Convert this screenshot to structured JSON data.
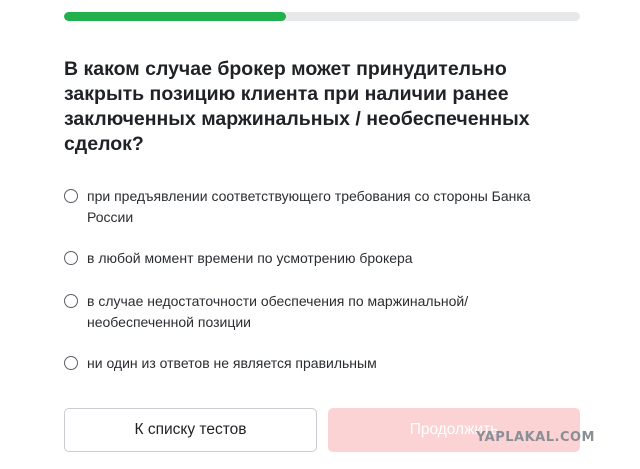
{
  "progress": {
    "value_percent": 43,
    "fill_color": "#21b04b",
    "track_color": "#e7e8ea"
  },
  "question": {
    "text": "В каком случае брокер может принудительно закрыть позицию клиента при наличии ранее заключенных маржинальных / необеспеченных сделок?"
  },
  "options": [
    {
      "label": "при предъявлении соответствующего требования со стороны Банка России",
      "selected": false
    },
    {
      "label": "в любой момент времени по усмотрению брокера",
      "selected": false
    },
    {
      "label": "в случае недостаточности обеспечения по маржинальной/ необеспеченной позиции",
      "selected": false
    },
    {
      "label": "ни один из ответов не является правильным",
      "selected": false
    }
  ],
  "buttons": {
    "back_label": "К списку тестов",
    "next_label": "Продолжить",
    "next_color": "#fbd3d4"
  },
  "watermark": {
    "text": "YAPLAKAL.COM"
  }
}
